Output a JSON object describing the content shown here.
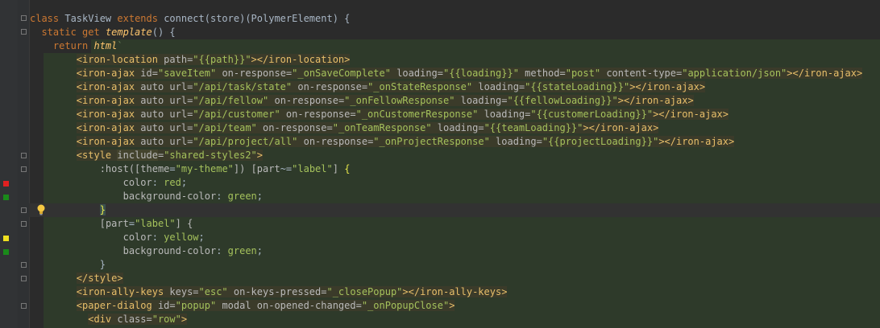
{
  "editor": {
    "lines": [
      "class TaskView extends connect(store)(PolymerElement) {",
      "  static get template() {",
      "    return html`",
      "        <iron-location path=\"{{path}}\"></iron-location>",
      "        <iron-ajax id=\"saveItem\" on-response=\"_onSaveComplete\" loading=\"{{loading}}\" method=\"post\" content-type=\"application/json\"></iron-ajax>",
      "        <iron-ajax auto url=\"/api/task/state\" on-response=\"_onStateResponse\" loading=\"{{stateLoading}}\"></iron-ajax>",
      "        <iron-ajax auto url=\"/api/fellow\" on-response=\"_onFellowResponse\" loading=\"{{fellowLoading}}\"></iron-ajax>",
      "        <iron-ajax auto url=\"/api/customer\" on-response=\"_onCustomerResponse\" loading=\"{{customerLoading}}\"></iron-ajax>",
      "        <iron-ajax auto url=\"/api/team\" on-response=\"_onTeamResponse\" loading=\"{{teamLoading}}\"></iron-ajax>",
      "        <iron-ajax auto url=\"/api/project/all\" on-response=\"_onProjectResponse\" loading=\"{{projectLoading}}\"></iron-ajax>",
      "        <style include=\"shared-styles2\">",
      "            :host([theme=\"my-theme\"]) [part~=\"label\"] {",
      "                color: red;",
      "                background-color: green;",
      "            }",
      "            [part=\"label\"] {",
      "                color: yellow;",
      "                background-color: green;",
      "            }",
      "        </style>",
      "        <iron-ally-keys keys=\"esc\" on-keys-pressed=\"_closePopup\"></iron-ally-keys>",
      "        <paper-dialog id=\"popup\" modal on-opened-changed=\"_onPopupClose\">",
      "          <div class=\"row\">"
    ],
    "gutter_markers": [
      {
        "line": 12,
        "color": "#e02020"
      },
      {
        "line": 13,
        "color": "#1a8a1a"
      },
      {
        "line": 16,
        "color": "#f0e020"
      },
      {
        "line": 17,
        "color": "#1a8a1a"
      }
    ],
    "caret_line": 14
  }
}
